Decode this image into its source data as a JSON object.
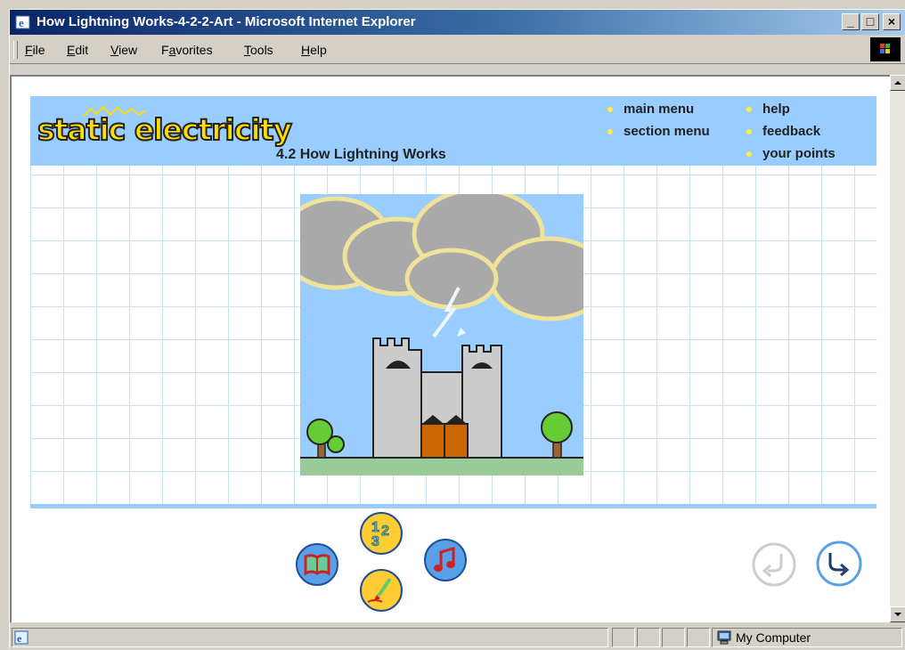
{
  "window": {
    "title": "How Lightning Works-4-2-2-Art - Microsoft Internet Explorer",
    "buttons": {
      "minimize": "_",
      "maximize": "□",
      "close": "×"
    }
  },
  "menubar": {
    "items": [
      {
        "label": "File",
        "mnemonic": "F"
      },
      {
        "label": "Edit",
        "mnemonic": "E"
      },
      {
        "label": "View",
        "mnemonic": "V"
      },
      {
        "label": "Favorites",
        "mnemonic": "a"
      },
      {
        "label": "Tools",
        "mnemonic": "T"
      },
      {
        "label": "Help",
        "mnemonic": "H"
      }
    ]
  },
  "page": {
    "logo_text": "static electricity",
    "section_title": "4.2 How Lightning Works",
    "nav": {
      "main_menu": "main menu",
      "section_menu": "section menu",
      "help": "help",
      "feedback": "feedback",
      "your_points": "your points"
    },
    "activity_icons": [
      "book-icon",
      "numbers-icon",
      "music-note-icon",
      "paintbrush-icon"
    ],
    "activity_glyphs": {
      "numbers": [
        "1",
        "2",
        "3"
      ]
    },
    "navigation_icons": [
      "back-arrow-icon",
      "forward-arrow-icon"
    ],
    "colors": {
      "header": "#99ccff",
      "grid": "#c9dff5",
      "logo": "#ffdd00",
      "sky": "#99ccff",
      "grass": "#99cc99"
    }
  },
  "statusbar": {
    "zone": "My Computer"
  }
}
